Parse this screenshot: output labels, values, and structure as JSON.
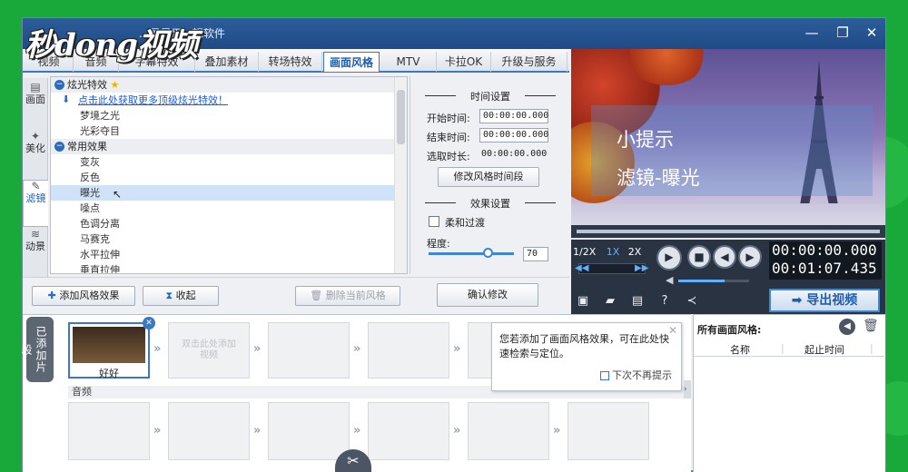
{
  "window": {
    "title": "...最易用...辑软件",
    "controls": {
      "minimize": "—",
      "maximize": "❐",
      "close": "✕"
    }
  },
  "watermark": {
    "text": "秒dong视频"
  },
  "tabs": [
    "视频",
    "音频",
    "字幕特效",
    "叠加素材",
    "转场特效",
    "画面风格",
    "MTV",
    "卡拉OK",
    "升级与服务"
  ],
  "side_tabs": [
    {
      "icon": "▤",
      "label": "画面"
    },
    {
      "icon": "✦",
      "label": "美化"
    },
    {
      "icon": "✎",
      "label": "滤镜"
    },
    {
      "icon": "≋",
      "label": "动景"
    }
  ],
  "effects_list": {
    "group1": "炫光特效",
    "link": "点击此处获取更多顶级炫光特效！",
    "group1_items": [
      "梦境之光",
      "光彩夺目"
    ],
    "group2": "常用效果",
    "group2_items": [
      "变灰",
      "反色",
      "曝光",
      "噪点",
      "色调分离",
      "马赛克",
      "水平拉伸",
      "垂直拉伸"
    ],
    "selected": "曝光"
  },
  "time_settings": {
    "title": "时间设置",
    "start_label": "开始时间:",
    "start_value": "00:00:00.000",
    "end_label": "结束时间:",
    "end_value": "00:00:00.000",
    "duration_label": "选取时长:",
    "duration_value": "00:00:00.000",
    "modify_button": "修改风格时间段"
  },
  "effect_settings": {
    "title": "效果设置",
    "soft_transition": "柔和过渡",
    "degree_label": "程度:",
    "degree_value": "70",
    "degree_fraction": 0.7
  },
  "bottom_buttons": {
    "add_effect": "添加风格效果",
    "collapse": "收起",
    "delete_current": "删除当前风格",
    "confirm": "确认修改"
  },
  "preview": {
    "overlay_title": "小提示",
    "overlay_text": "滤镜-曝光"
  },
  "playback": {
    "speeds": [
      "1/2X",
      "1X",
      "2X"
    ],
    "active_speed": "1X",
    "current_time": "00:00:00.000",
    "total_time": "00:01:07.435",
    "volume_fraction": 0.65
  },
  "export_button": "导出视频",
  "timeline": {
    "section_label": "已添加片段",
    "clip_name": "好好",
    "placeholder": "双击此处添加视频",
    "audio_label": "音频"
  },
  "tooltip": {
    "text": "您若添加了画面风格效果，可在此处快速检索与定位。",
    "checkbox_label": "下次不再提示"
  },
  "right_panel": {
    "title": "所有画面风格:",
    "col_name": "名称",
    "col_time": "起止时间"
  },
  "colors": {
    "accent": "#3b78c4",
    "green_bg": "#19a93a",
    "titlebar": "#2c5d9a"
  }
}
